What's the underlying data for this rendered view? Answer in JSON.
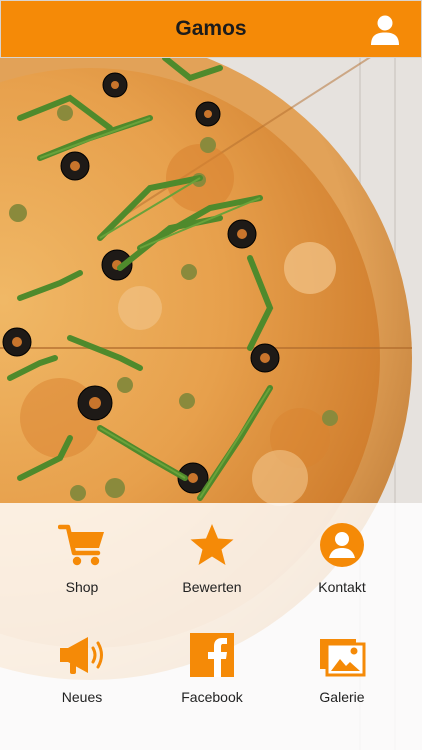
{
  "header": {
    "title": "Gamos",
    "profile_icon": "user-icon"
  },
  "background": {
    "image": "pizza-photo"
  },
  "menu": {
    "items": [
      {
        "label": "Shop",
        "icon": "shopping-cart-icon"
      },
      {
        "label": "Bewerten",
        "icon": "star-icon"
      },
      {
        "label": "Kontakt",
        "icon": "contact-user-icon"
      },
      {
        "label": "Neues",
        "icon": "megaphone-icon"
      },
      {
        "label": "Facebook",
        "icon": "facebook-icon"
      },
      {
        "label": "Galerie",
        "icon": "gallery-icon"
      }
    ]
  },
  "colors": {
    "accent": "#f58a07",
    "text": "#222222"
  }
}
